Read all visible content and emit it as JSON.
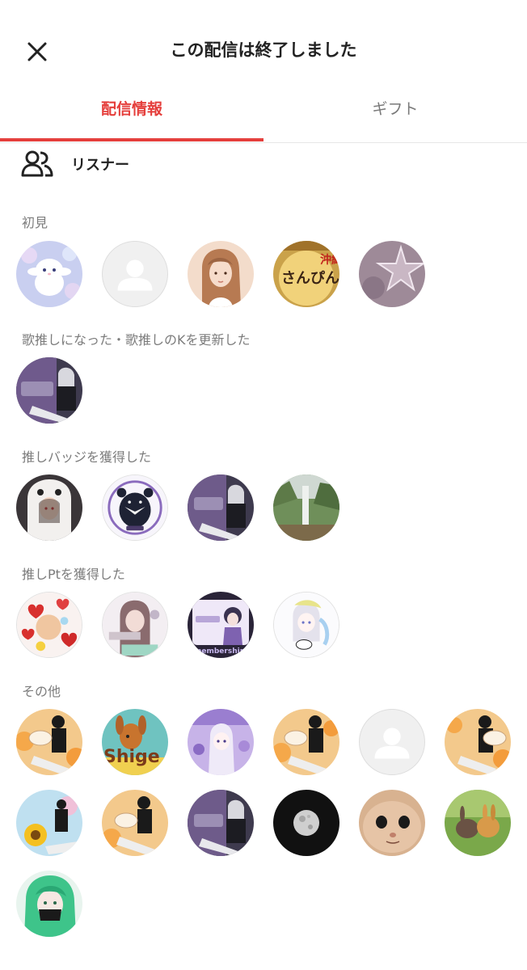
{
  "header": {
    "title": "この配信は終了しました"
  },
  "tabs": [
    {
      "label": "配信情報",
      "active": true
    },
    {
      "label": "ギフト",
      "active": false
    }
  ],
  "listeners": {
    "label": "リスナー"
  },
  "sections": [
    {
      "label": "初見"
    },
    {
      "label": "歌推しになった・歌推しのKを更新した"
    },
    {
      "label": "推しバッジを獲得した"
    },
    {
      "label": "推しPtを獲得した"
    },
    {
      "label": "その他"
    }
  ],
  "avatar_text": {
    "shigeo": "Shige",
    "okinawa": "沖縄",
    "sanpin": "さんぴん",
    "membership": "membership"
  },
  "colors": {
    "accent": "#e53f3c",
    "inactive_tab": "#7a7a7a",
    "section_label": "#7c7c7c"
  }
}
